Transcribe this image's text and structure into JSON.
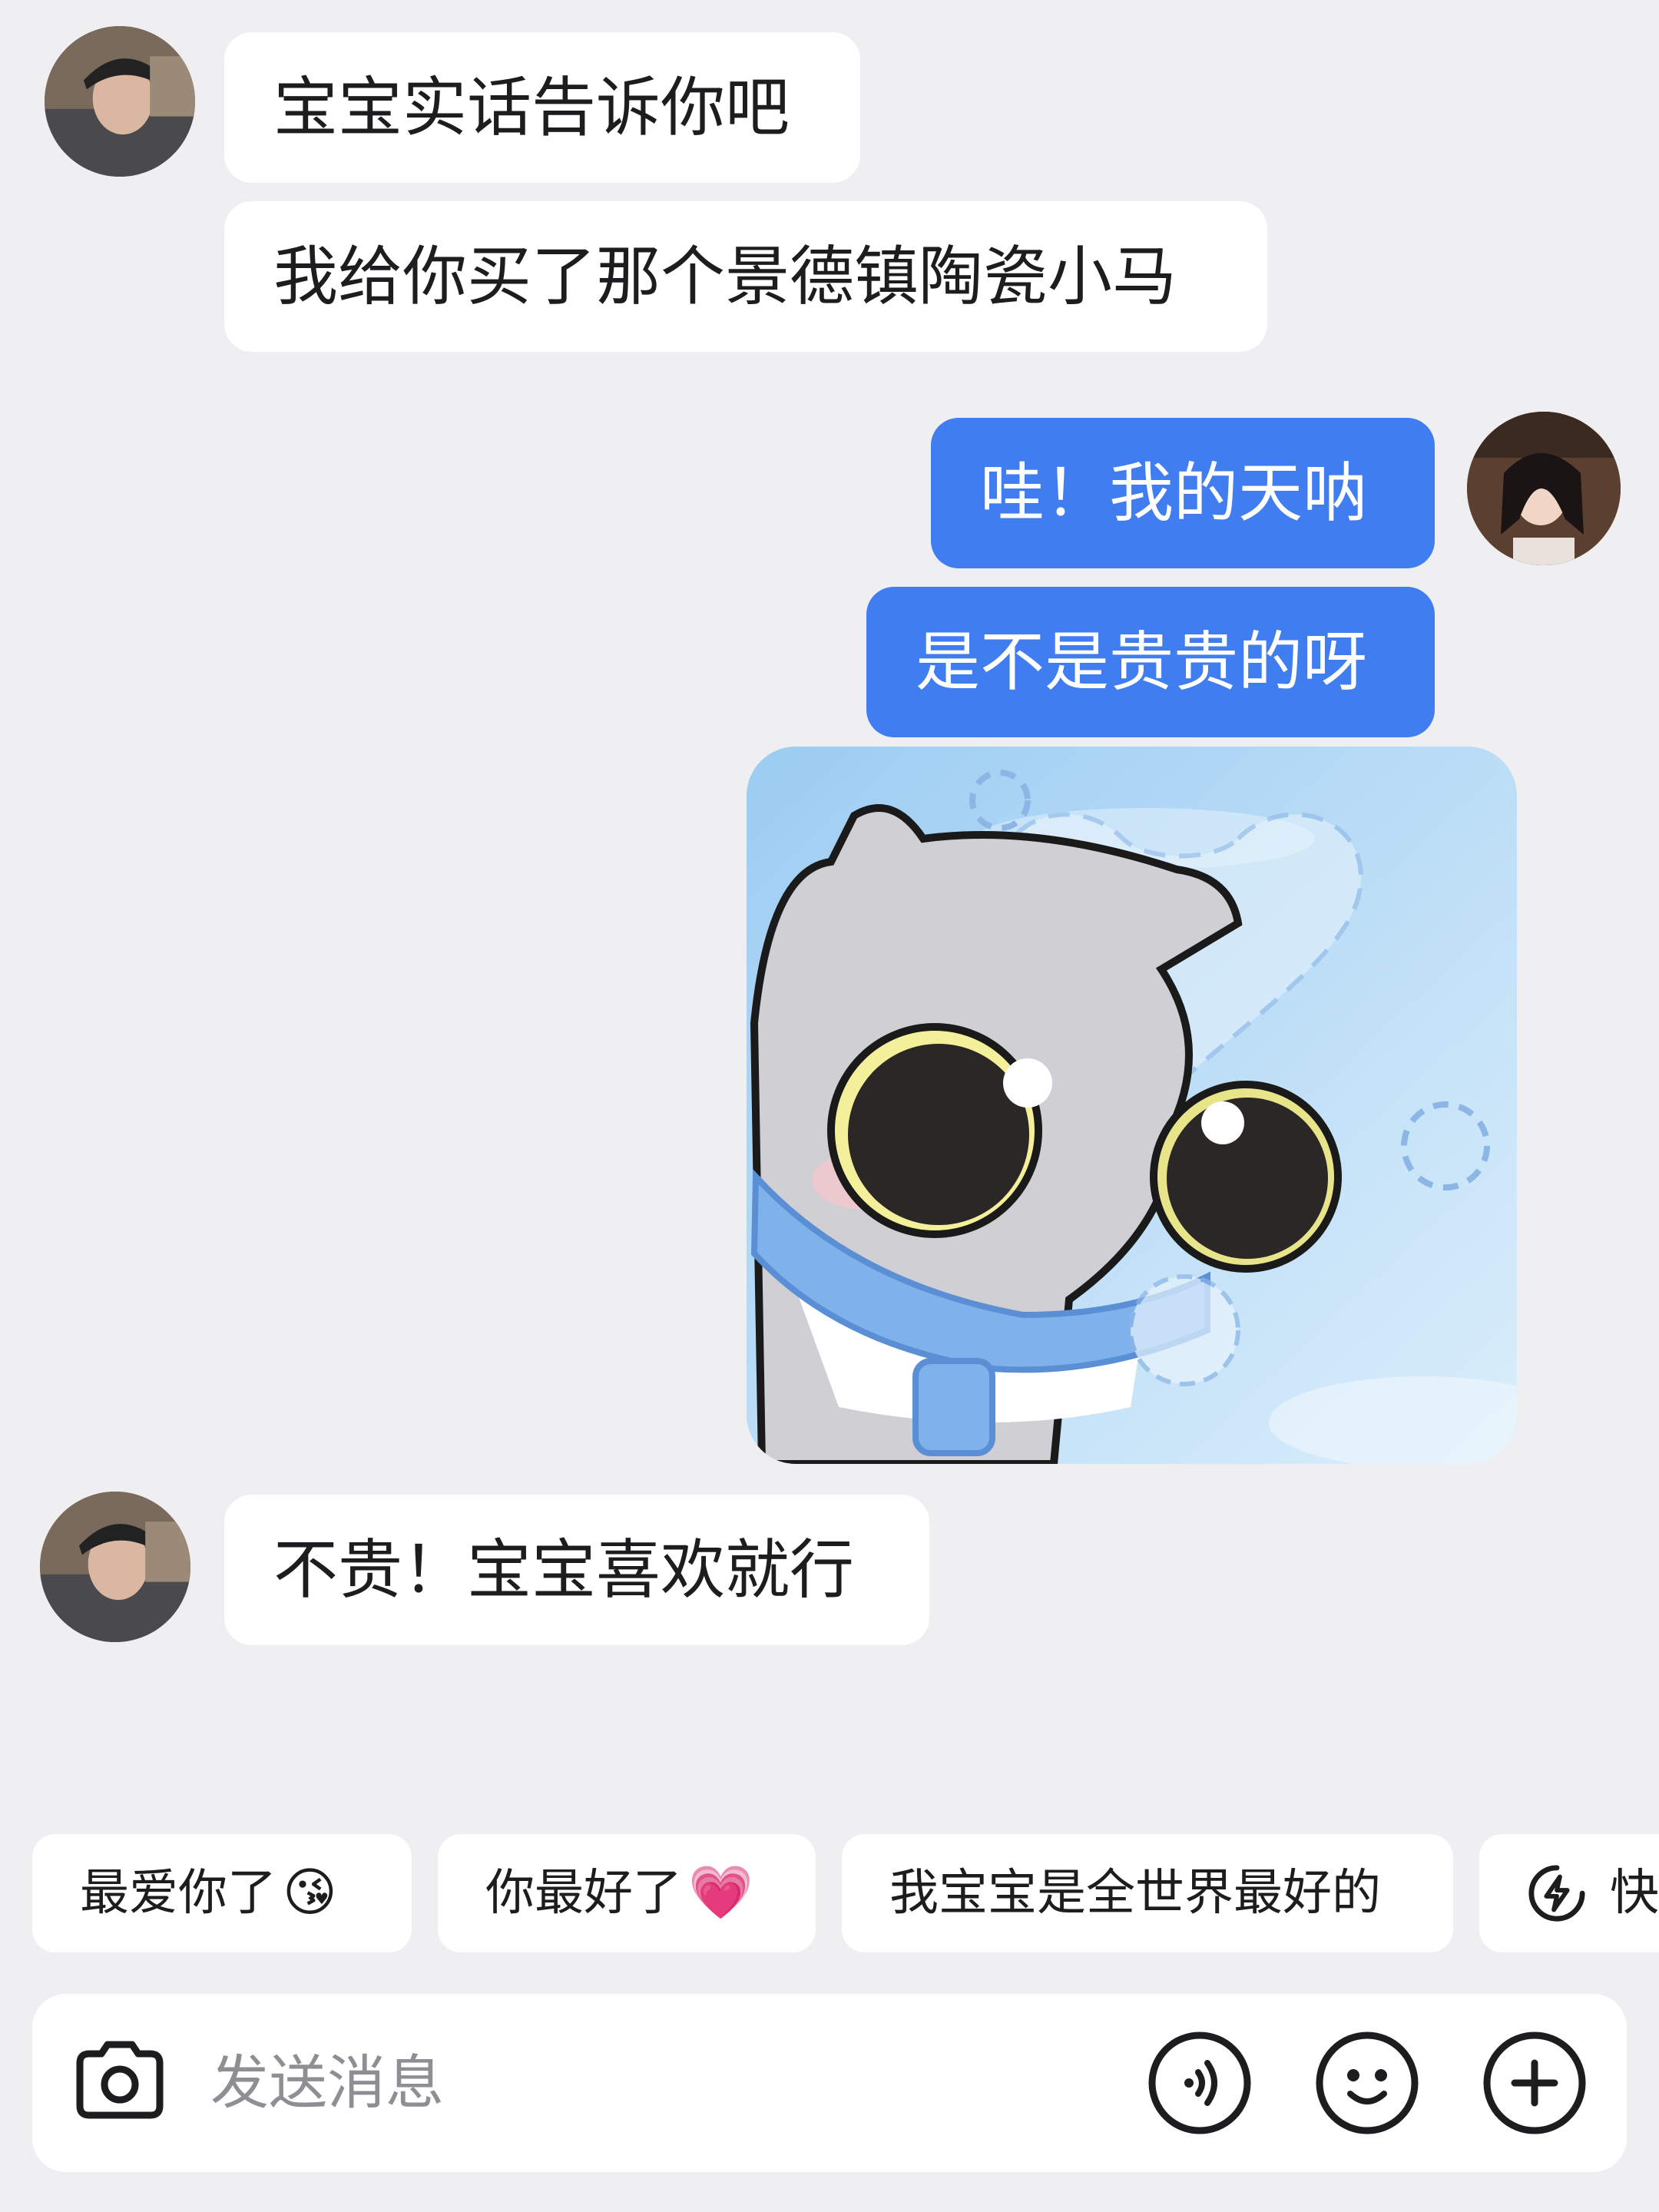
{
  "messages": [
    {
      "sender": "other",
      "text": "宝宝实话告诉你吧"
    },
    {
      "sender": "other",
      "text": "我给你买了那个景德镇陶瓷小马"
    },
    {
      "sender": "me",
      "text": "哇！我的天呐"
    },
    {
      "sender": "me",
      "text": "是不是贵贵的呀"
    },
    {
      "sender": "me",
      "type": "sticker",
      "icon": "cat-sticker-icon"
    },
    {
      "sender": "other",
      "text": "不贵！宝宝喜欢就行"
    }
  ],
  "quick_replies": [
    {
      "label": "最爱你了",
      "emoji": "😘"
    },
    {
      "label": "你最好了",
      "emoji": "💗"
    },
    {
      "label": "我宝宝是全世界最好的"
    },
    {
      "label": "快",
      "icon": "lightning-icon"
    }
  ],
  "input": {
    "placeholder": "发送消息",
    "icons": [
      "camera-icon",
      "voice-icon",
      "emoji-icon",
      "plus-icon"
    ]
  },
  "colors": {
    "background": "#efeff1",
    "outgoing_bubble": "#3f7df0",
    "incoming_bubble": "#ffffff"
  }
}
